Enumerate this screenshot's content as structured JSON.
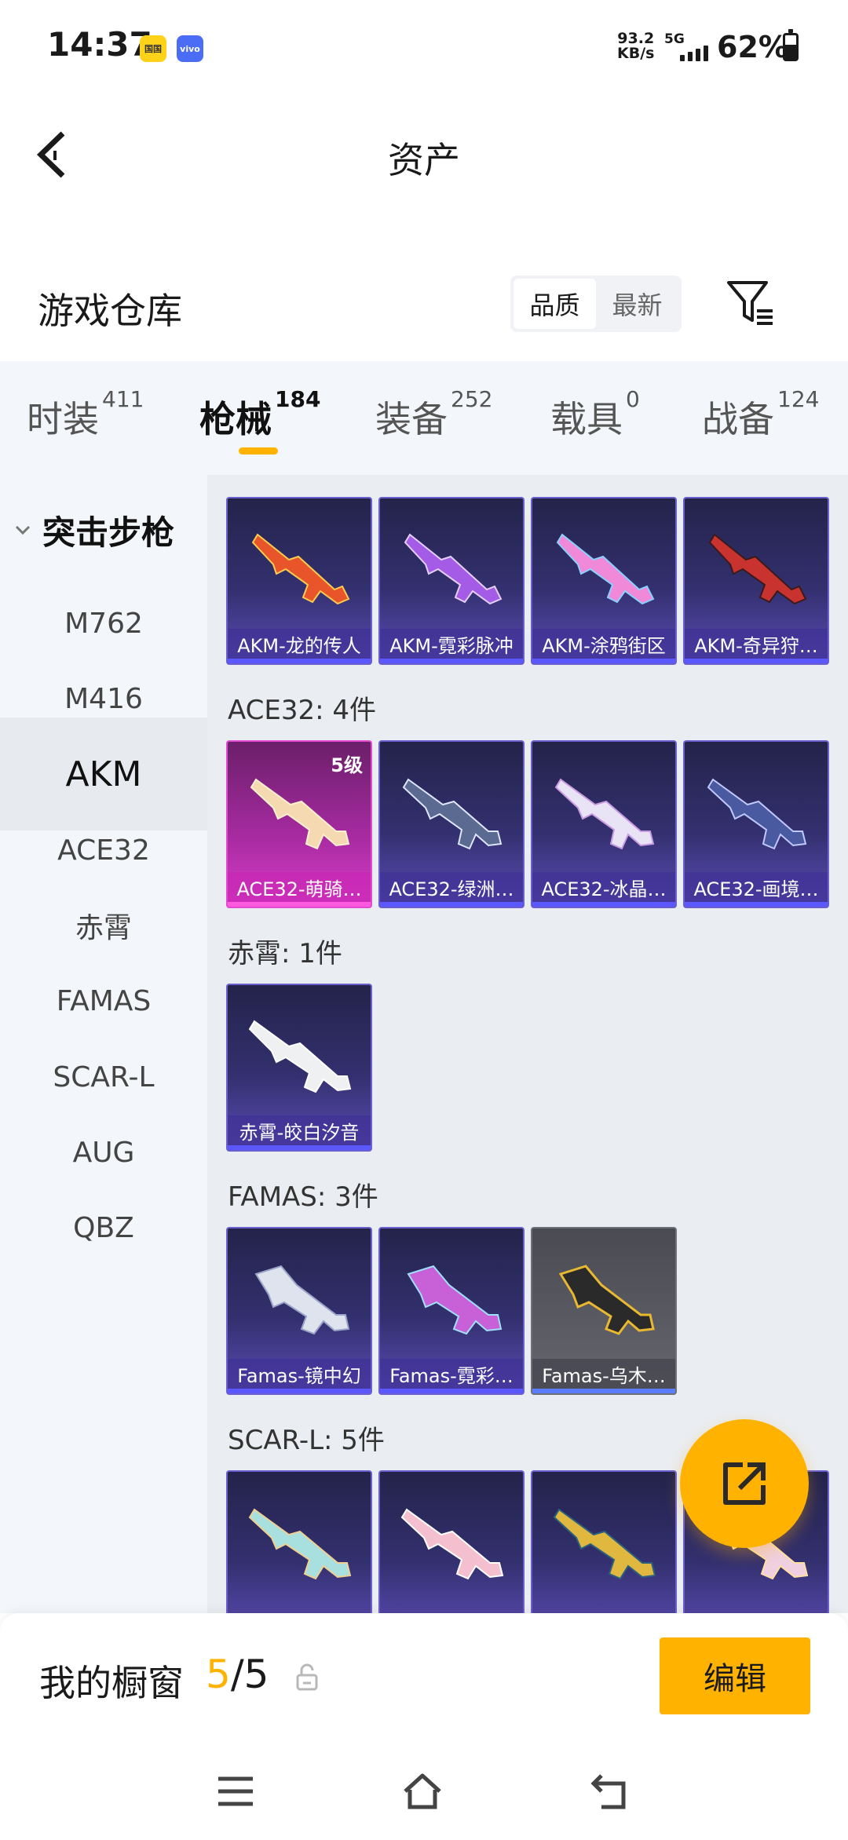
{
  "status": {
    "time": "14:37",
    "app_icon_1": "国国",
    "app_icon_2": "vivo",
    "speed_value": "93.2",
    "speed_unit": "KB/s",
    "network": "5G",
    "battery": "62%"
  },
  "header": {
    "title": "资产"
  },
  "warehouse": {
    "title": "游戏仓库",
    "sort_options": [
      "品质",
      "最新"
    ]
  },
  "tabs": [
    {
      "label": "时装",
      "count": "411"
    },
    {
      "label": "枪械",
      "count": "184"
    },
    {
      "label": "装备",
      "count": "252"
    },
    {
      "label": "载具",
      "count": "0"
    },
    {
      "label": "战备",
      "count": "124"
    }
  ],
  "sidebar": {
    "header": "突击步枪",
    "items": [
      "M762",
      "M416",
      "AKM",
      "ACE32",
      "赤霄",
      "FAMAS",
      "SCAR-L",
      "AUG",
      "QBZ"
    ]
  },
  "groups": {
    "akm": {
      "items": [
        "AKM-龙的传人",
        "AKM-霓彩脉冲",
        "AKM-涂鸦街区",
        "AKM-奇异狩…"
      ]
    },
    "ace32": {
      "label": "ACE32: 4件",
      "level": "5级",
      "items": [
        "ACE32-萌骑…",
        "ACE32-绿洲…",
        "ACE32-冰晶…",
        "ACE32-画境…"
      ]
    },
    "chixiao": {
      "label": "赤霄: 1件",
      "items": [
        "赤霄-皎白汐音"
      ]
    },
    "famas": {
      "label": "FAMAS: 3件",
      "items": [
        "Famas-镜中幻",
        "Famas-霓彩…",
        "Famas-乌木…"
      ]
    },
    "scarl": {
      "label": "SCAR-L: 5件"
    }
  },
  "bottom": {
    "window_label": "我的橱窗",
    "window_current": "5",
    "window_total": "/5",
    "edit_label": "编辑"
  },
  "colors": {
    "accent": "#ffb300",
    "card_purple": "#33306f",
    "card_pink": "#a42a9e",
    "card_gray": "#5b5b63"
  }
}
